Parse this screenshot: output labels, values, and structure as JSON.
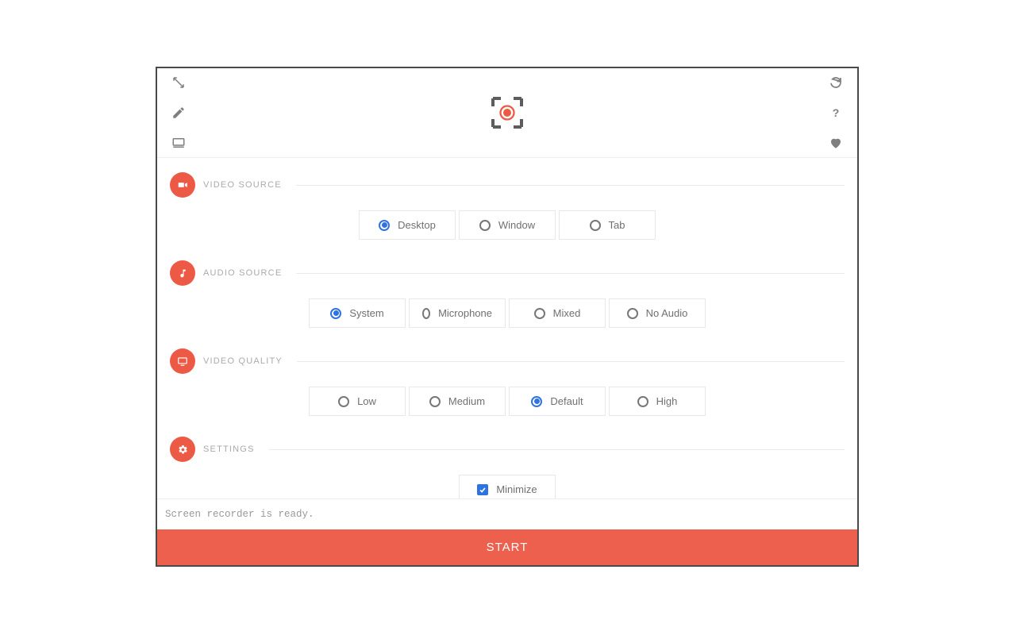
{
  "header": {
    "icons_left": [
      "resize",
      "edit",
      "desktop"
    ],
    "icons_right": [
      "refresh",
      "help",
      "heart"
    ]
  },
  "sections": {
    "video_source": {
      "title": "VIDEO SOURCE",
      "options": [
        "Desktop",
        "Window",
        "Tab"
      ],
      "selected": "Desktop"
    },
    "audio_source": {
      "title": "AUDIO SOURCE",
      "options": [
        "System",
        "Microphone",
        "Mixed",
        "No Audio"
      ],
      "selected": "System"
    },
    "video_quality": {
      "title": "VIDEO QUALITY",
      "options": [
        "Low",
        "Medium",
        "Default",
        "High"
      ],
      "selected": "Default"
    },
    "settings": {
      "title": "SETTINGS",
      "minimize_label": "Minimize",
      "minimize_checked": true
    }
  },
  "status": "Screen recorder is ready.",
  "start": "START"
}
